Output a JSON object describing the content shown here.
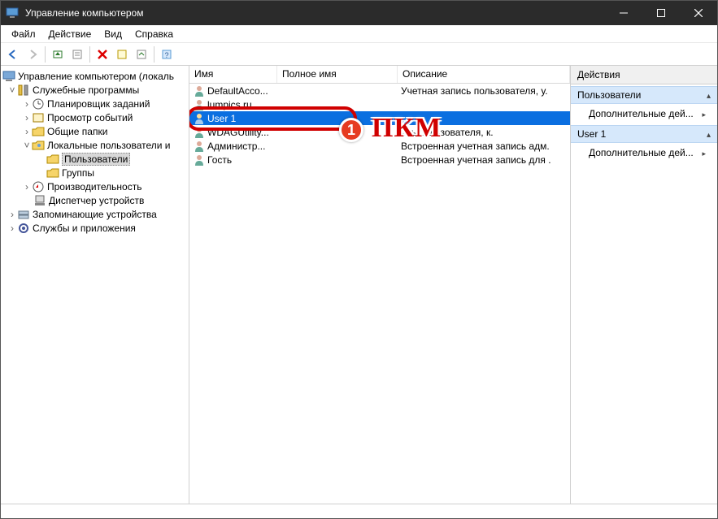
{
  "titlebar": {
    "title": "Управление компьютером"
  },
  "menu": {
    "file": "Файл",
    "action": "Действие",
    "view": "Вид",
    "help": "Справка"
  },
  "tree": {
    "root": "Управление компьютером (локаль",
    "system_tools": "Служебные программы",
    "task_scheduler": "Планировщик заданий",
    "event_viewer": "Просмотр событий",
    "shared_folders": "Общие папки",
    "local_users": "Локальные пользователи и",
    "users": "Пользователи",
    "groups": "Группы",
    "performance": "Производительность",
    "device_manager": "Диспетчер устройств",
    "storage": "Запоминающие устройства",
    "services": "Службы и приложения"
  },
  "list": {
    "col_name": "Имя",
    "col_full": "Полное имя",
    "col_desc": "Описание",
    "rows": [
      {
        "name": "DefaultAcco...",
        "full": "",
        "desc": "Учетная запись пользователя, у."
      },
      {
        "name": "lumpics.ru",
        "full": "",
        "desc": ""
      },
      {
        "name": "User 1",
        "full": "",
        "desc": ""
      },
      {
        "name": "WDAGUtility...",
        "full": "",
        "desc": "ись пользователя, к."
      },
      {
        "name": "Администр...",
        "full": "",
        "desc": "Встроенная учетная запись адм."
      },
      {
        "name": "Гость",
        "full": "",
        "desc": "Встроенная учетная запись для ."
      }
    ]
  },
  "actions": {
    "title": "Действия",
    "group1": "Пользователи",
    "more1": "Дополнительные дей...",
    "group2": "User 1",
    "more2": "Дополнительные дей..."
  },
  "callout": {
    "num": "1",
    "text": "ПКМ"
  }
}
